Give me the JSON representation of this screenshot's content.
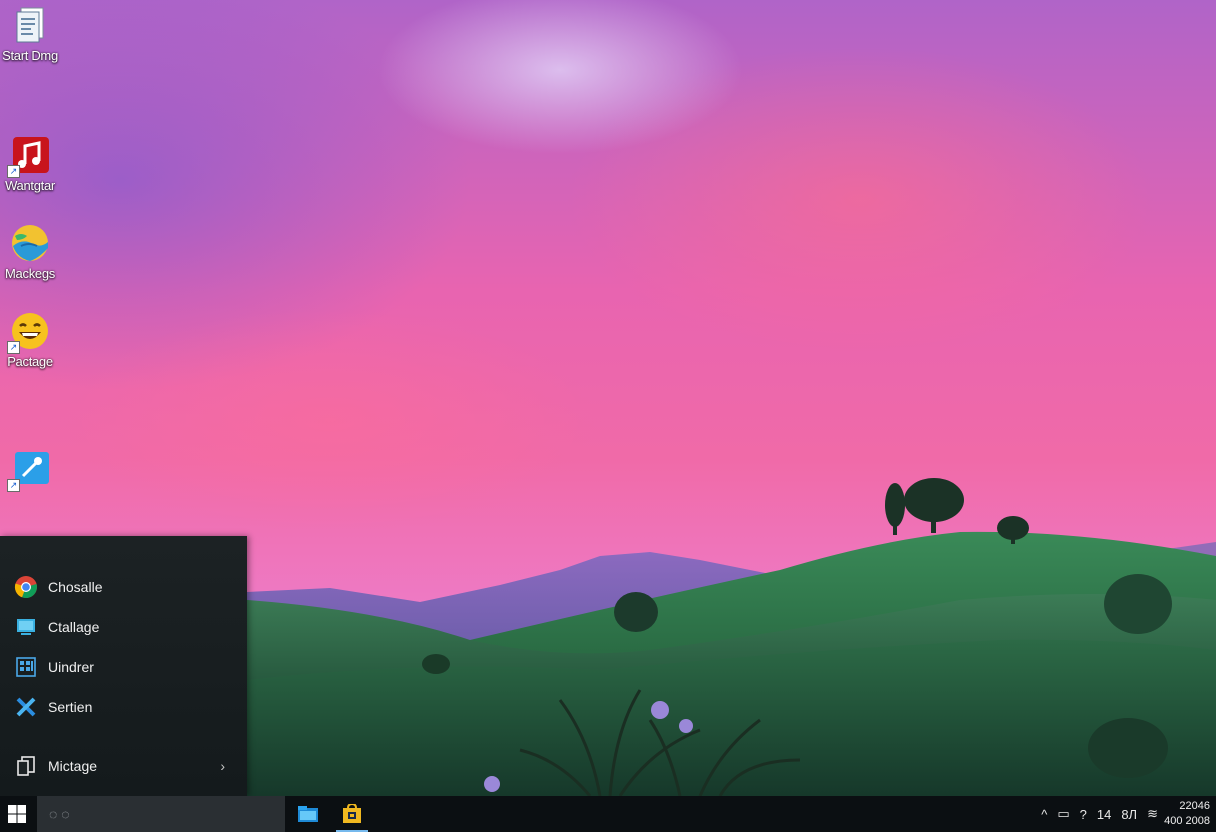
{
  "desktop": {
    "icons": [
      {
        "label": "Start Dmg",
        "icon": "document-icon"
      },
      {
        "label": "Wantgtar",
        "icon": "music-icon"
      },
      {
        "label": "Mackegs",
        "icon": "globe-icon"
      },
      {
        "label": "Pactage",
        "icon": "emoji-icon"
      },
      {
        "label": "",
        "icon": "tool-shortcut-icon"
      }
    ]
  },
  "start_menu": {
    "items": [
      {
        "label": "Chosalle",
        "icon": "chrome-icon"
      },
      {
        "label": "Ctallage",
        "icon": "monitor-icon"
      },
      {
        "label": "Uindrer",
        "icon": "calculator-icon"
      },
      {
        "label": "Sertien",
        "icon": "tools-icon"
      },
      {
        "label": "Mictage",
        "icon": "documents-icon",
        "arrow": "›"
      }
    ]
  },
  "taskbar": {
    "search_text": "◌ ◌",
    "apps": [
      {
        "name": "file-explorer-icon",
        "active": false
      },
      {
        "name": "store-icon",
        "active": true
      }
    ],
    "tray": [
      "^",
      "▭",
      "?",
      "14",
      "8Л",
      "≋"
    ],
    "clock": {
      "time": "22046",
      "date": "400 2008"
    }
  },
  "colors": {
    "taskbar_bg": "#0b0f12",
    "start_menu_bg": "#1c2224",
    "accent": "#76b9ed"
  }
}
